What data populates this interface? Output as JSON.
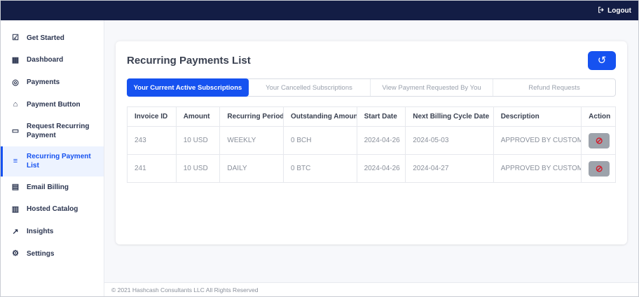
{
  "header": {
    "logout_label": "Logout"
  },
  "sidebar": {
    "items": [
      {
        "label": "Get Started",
        "icon": "checkbox-icon",
        "glyph": "☑"
      },
      {
        "label": "Dashboard",
        "icon": "grid-icon",
        "glyph": "▦"
      },
      {
        "label": "Payments",
        "icon": "coin-icon",
        "glyph": "◎"
      },
      {
        "label": "Payment Button",
        "icon": "bank-icon",
        "glyph": "⌂"
      },
      {
        "label": "Request Recurring Payment",
        "icon": "card-icon",
        "glyph": "▭"
      },
      {
        "label": "Recurring Payment List",
        "icon": "list-icon",
        "glyph": "≡",
        "active": true
      },
      {
        "label": "Email Billing",
        "icon": "document-icon",
        "glyph": "▤"
      },
      {
        "label": "Hosted Catalog",
        "icon": "book-icon",
        "glyph": "▥"
      },
      {
        "label": "Insights",
        "icon": "chart-icon",
        "glyph": "↗"
      },
      {
        "label": "Settings",
        "icon": "gear-icon",
        "glyph": "⚙"
      }
    ]
  },
  "main": {
    "title": "Recurring Payments List",
    "refresh_glyph": "↺",
    "tabs": [
      {
        "label": "Your Current Active Subscriptions",
        "active": true
      },
      {
        "label": "Your Cancelled Subscriptions",
        "active": false
      },
      {
        "label": "View Payment Requested By You",
        "active": false
      },
      {
        "label": "Refund Requests",
        "active": false
      }
    ],
    "table": {
      "columns": [
        "Invoice ID",
        "Amount",
        "Recurring Period",
        "Outstanding Amount",
        "Start Date",
        "Next Billing Cycle Date",
        "Description",
        "Action"
      ],
      "rows": [
        {
          "invoice_id": "243",
          "amount": "10 USD",
          "recurring_period": "WEEKLY",
          "outstanding_amount": "0 BCH",
          "start_date": "2024-04-26",
          "next_billing_cycle_date": "2024-05-03",
          "description": "APPROVED BY CUSTOMER"
        },
        {
          "invoice_id": "241",
          "amount": "10 USD",
          "recurring_period": "DAILY",
          "outstanding_amount": "0 BTC",
          "start_date": "2024-04-26",
          "next_billing_cycle_date": "2024-04-27",
          "description": "APPROVED BY CUSTOMER"
        }
      ],
      "action_glyph": "⊘"
    }
  },
  "footer": {
    "copyright": "© 2021 Hashcash Consultants LLC All Rights Reserved"
  },
  "colors": {
    "header_bg": "#131d45",
    "accent_blue": "#1652f0",
    "action_red": "#d1202f",
    "action_gray": "#9da3ab",
    "main_bg": "#f7f8fb"
  }
}
